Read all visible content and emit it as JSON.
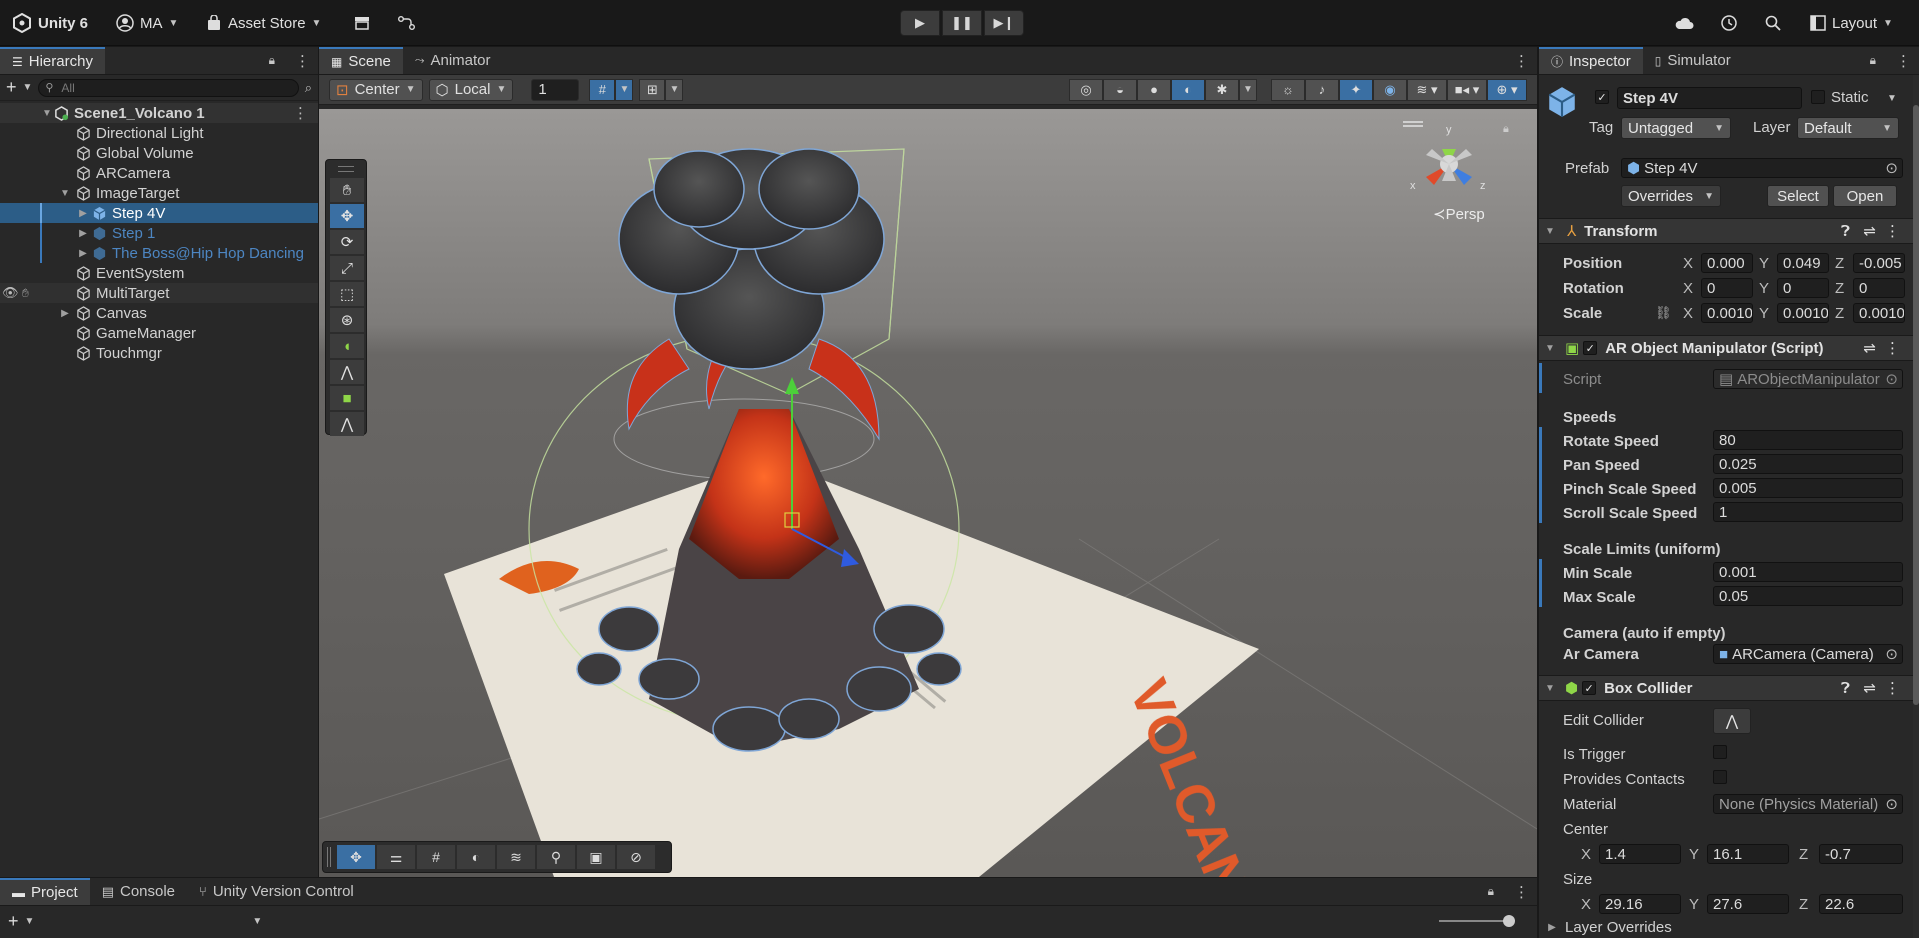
{
  "toolbar": {
    "app_name": "Unity 6",
    "account": "MA",
    "asset_store": "Asset Store",
    "layout": "Layout"
  },
  "hierarchy": {
    "tab": "Hierarchy",
    "search_placeholder": "All",
    "scene_name": "Scene1_Volcano 1",
    "items": [
      {
        "label": "Directional Light"
      },
      {
        "label": "Global Volume"
      },
      {
        "label": "ARCamera"
      },
      {
        "label": "ImageTarget"
      },
      {
        "label": "Step 4V"
      },
      {
        "label": "Step 1"
      },
      {
        "label": "The Boss@Hip Hop Dancing"
      },
      {
        "label": "EventSystem"
      },
      {
        "label": "MultiTarget"
      },
      {
        "label": "Canvas"
      },
      {
        "label": "GameManager"
      },
      {
        "label": "Touchmgr"
      }
    ]
  },
  "scene": {
    "tabs": [
      "Scene",
      "Animator"
    ],
    "pivot": "Center",
    "space": "Local",
    "snap_value": "1",
    "persp": "Persp",
    "gizmo_axes": {
      "x": "x",
      "y": "y",
      "z": "z"
    },
    "poster_title": "VOLCANO"
  },
  "bottom": {
    "tabs": [
      "Project",
      "Console",
      "Unity Version Control"
    ]
  },
  "inspector": {
    "tabs": [
      "Inspector",
      "Simulator"
    ],
    "object_name": "Step 4V",
    "static_label": "Static",
    "tag_label": "Tag",
    "tag_value": "Untagged",
    "layer_label": "Layer",
    "layer_value": "Default",
    "prefab_label": "Prefab",
    "prefab_value": "Step 4V",
    "overrides": "Overrides",
    "select": "Select",
    "open": "Open",
    "transform": {
      "title": "Transform",
      "position_label": "Position",
      "position": [
        "0.000",
        "0.049",
        "-0.005"
      ],
      "rotation_label": "Rotation",
      "rotation": [
        "0",
        "0",
        "0"
      ],
      "scale_label": "Scale",
      "scale": [
        "0.0010",
        "0.0010",
        "0.0010"
      ]
    },
    "ar_manipulator": {
      "title": "AR Object Manipulator (Script)",
      "script_label": "Script",
      "script_value": "ARObjectManipulator",
      "speeds_label": "Speeds",
      "rotate_label": "Rotate Speed",
      "rotate_value": "80",
      "pan_label": "Pan Speed",
      "pan_value": "0.025",
      "pinch_label": "Pinch Scale Speed",
      "pinch_value": "0.005",
      "scroll_label": "Scroll Scale Speed",
      "scroll_value": "1",
      "limits_label": "Scale Limits (uniform)",
      "min_label": "Min Scale",
      "min_value": "0.001",
      "max_label": "Max Scale",
      "max_value": "0.05",
      "camera_header": "Camera (auto if empty)",
      "camera_label": "Ar Camera",
      "camera_value": "ARCamera (Camera)"
    },
    "box_collider": {
      "title": "Box Collider",
      "edit_label": "Edit Collider",
      "trigger_label": "Is Trigger",
      "contacts_label": "Provides Contacts",
      "material_label": "Material",
      "material_value": "None (Physics Material)",
      "center_label": "Center",
      "center": [
        "1.4",
        "16.1",
        "-0.7"
      ],
      "size_label": "Size",
      "size": [
        "29.16",
        "27.6",
        "22.6"
      ],
      "layer_overrides": "Layer Overrides"
    }
  }
}
